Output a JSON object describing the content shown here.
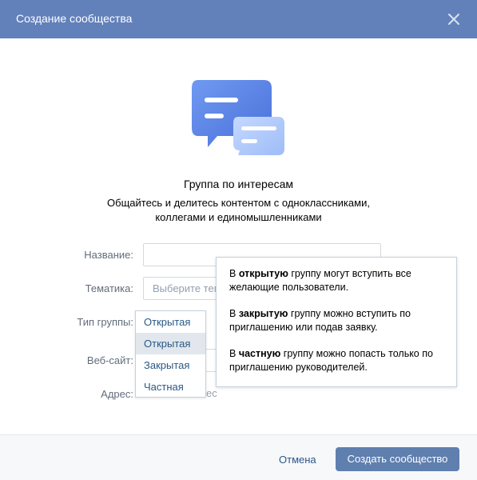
{
  "header": {
    "title": "Создание сообщества",
    "close_icon": "close-icon"
  },
  "intro": {
    "title": "Группа по интересам",
    "description_line1": "Общайтесь и делитесь контентом с одноклассниками,",
    "description_line2": "коллегами и единомышленниками"
  },
  "form": {
    "name_label": "Название:",
    "topic_label": "Тематика:",
    "topic_placeholder": "Выберите тем",
    "type_label": "Тип группы:",
    "website_label": "Веб-сайт:",
    "address_label": "Адрес:",
    "address_tail": "ес"
  },
  "group_type_dropdown": {
    "current": "Открытая",
    "options": [
      "Открытая",
      "Закрытая",
      "Частная"
    ]
  },
  "tooltip": {
    "p1_pre": "В ",
    "p1_bold": "открытую",
    "p1_post": " группу могут вступить все желающие пользователи.",
    "p2_pre": "В ",
    "p2_bold": "закрытую",
    "p2_post": " группу можно вступить по приглашению или подав заявку.",
    "p3_pre": "В ",
    "p3_bold": "частную",
    "p3_post": " группу можно попасть только по приглашению руководителей."
  },
  "footer": {
    "cancel_label": "Отмена",
    "create_label": "Создать сообщество"
  },
  "colors": {
    "header": "#6281bb",
    "link": "#2a5885",
    "button": "#5f7faf"
  }
}
